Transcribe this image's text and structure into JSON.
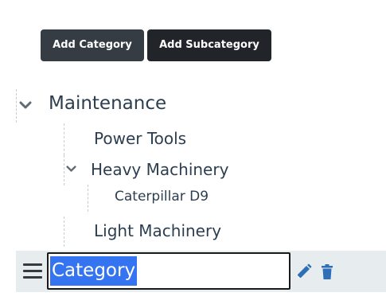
{
  "toolbar": {
    "add_category_label": "Add Category",
    "add_subcategory_label": "Add Subcategory"
  },
  "tree": {
    "root": {
      "label": "Maintenance",
      "expanded": true,
      "children": [
        {
          "label": "Power Tools"
        },
        {
          "label": "Heavy Machinery",
          "expanded": true,
          "children": [
            {
              "label": "Caterpillar D9"
            }
          ]
        },
        {
          "label": "Light Machinery"
        }
      ]
    }
  },
  "editor": {
    "value": "Category",
    "selected": true
  },
  "icons": {
    "expand": "chevron-down-icon",
    "drag": "drag-handle-icon",
    "edit": "pencil-icon",
    "delete": "trash-icon"
  },
  "colors": {
    "accent": "#3574f0",
    "icon_blue": "#2f6fb5",
    "button_dark": "#212529",
    "row_highlight": "#e7ecef",
    "text": "#2c3e50"
  }
}
